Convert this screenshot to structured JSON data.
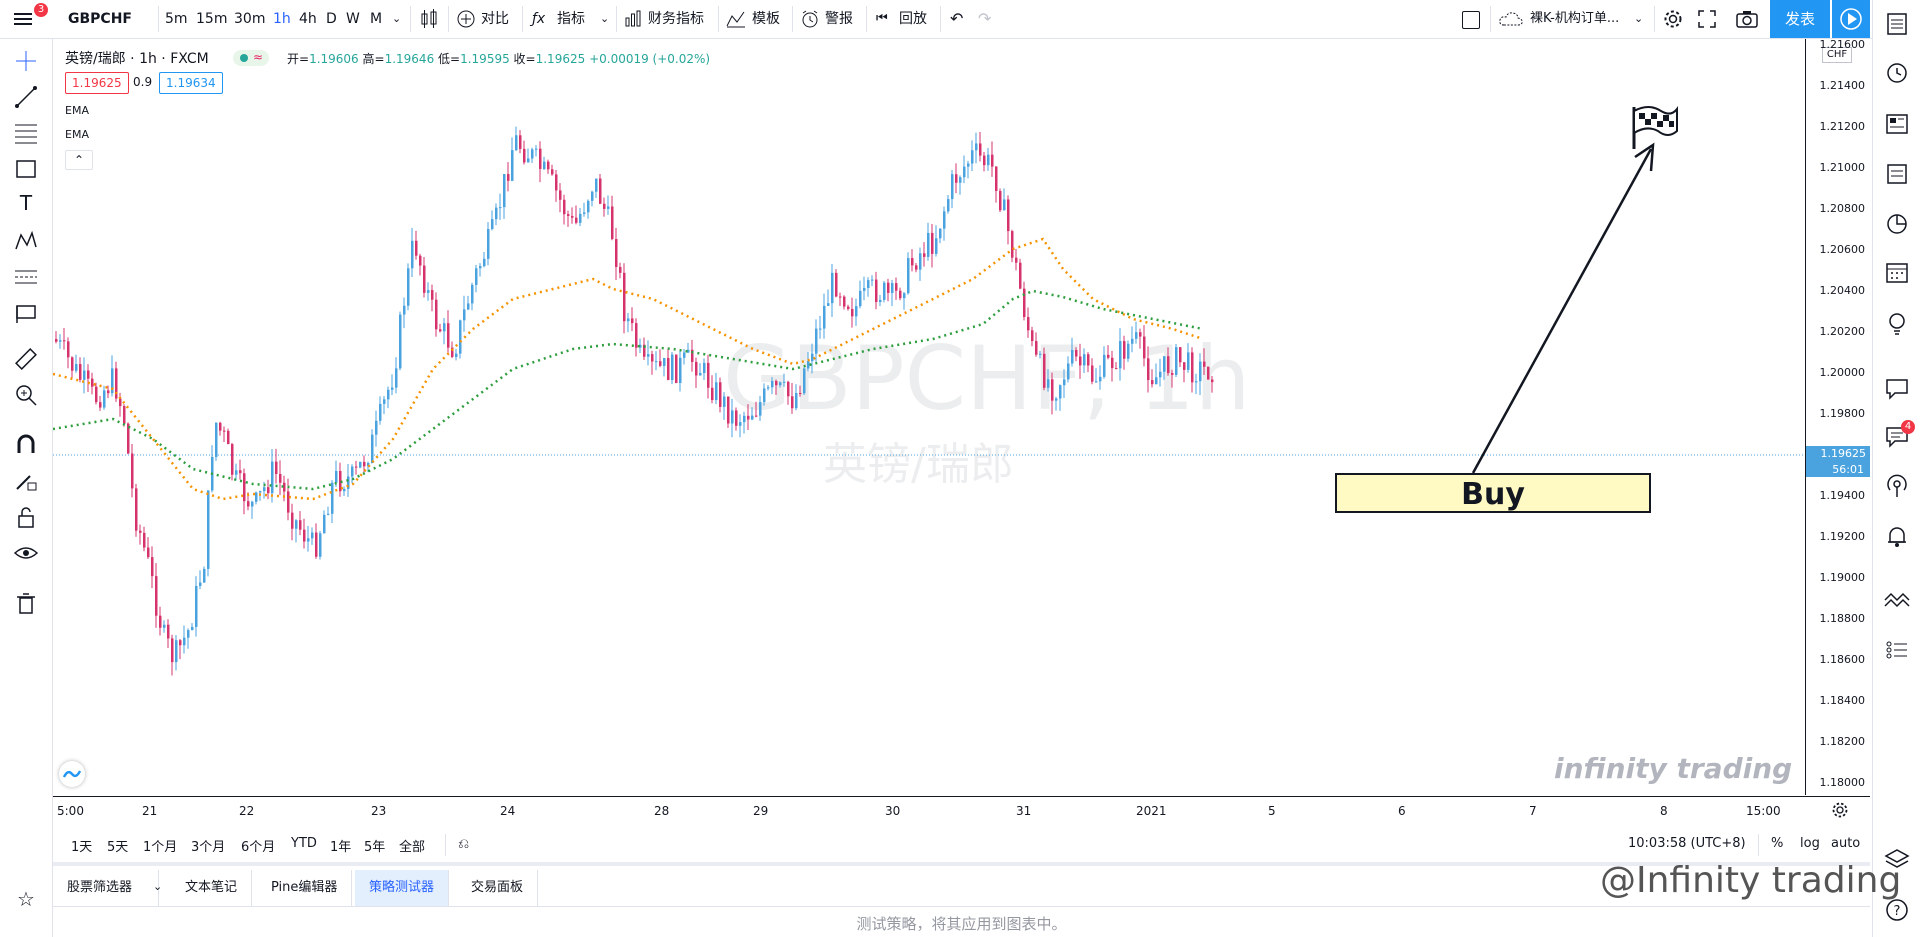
{
  "toolbar": {
    "menu_badge": "3",
    "symbol": "GBPCHF",
    "intervals": [
      "5m",
      "15m",
      "30m",
      "1h",
      "4h",
      "D",
      "W",
      "M"
    ],
    "selected_interval": "1h",
    "compare": "对比",
    "indicators": "指标",
    "financials": "财务指标",
    "templates": "模板",
    "alerts": "警报",
    "replay": "回放",
    "layout_name": "裸K-机构订单...",
    "publish": "发表"
  },
  "legend": {
    "title": "英镑/瑞郎 · 1h · FXCM",
    "open_label": "开=",
    "open": "1.19606",
    "high_label": "高=",
    "high": "1.19646",
    "low_label": "低=",
    "low": "1.19595",
    "close_label": "收=",
    "close": "1.19625",
    "change": "+0.00019 (+0.02%)",
    "bid": "1.19625",
    "spread": "0.9",
    "ask": "1.19634",
    "indicator1": "EMA",
    "indicator2": "EMA"
  },
  "watermark": {
    "line1": "GBPCHF, 1h",
    "line2": "英镑/瑞郎"
  },
  "price_axis": {
    "currency": "CHF",
    "labels": [
      "1.21600",
      "1.21400",
      "1.21200",
      "1.21000",
      "1.20800",
      "1.20600",
      "1.20400",
      "1.20200",
      "1.20000",
      "1.19800",
      "1.19625",
      "1.19400",
      "1.19200",
      "1.19000",
      "1.18800",
      "1.18600",
      "1.18400",
      "1.18200",
      "1.18000"
    ],
    "current_price": "1.19625",
    "countdown": "56:01"
  },
  "time_axis": {
    "labels": [
      "5:00",
      "21",
      "22",
      "23",
      "24",
      "28",
      "29",
      "30",
      "31",
      "2021",
      "5",
      "6",
      "7",
      "8",
      "15:00"
    ]
  },
  "annotation": {
    "buy": "Buy"
  },
  "range_bar": {
    "ranges": [
      "1天",
      "5天",
      "1个月",
      "3个月",
      "6个月",
      "YTD",
      "1年",
      "5年",
      "全部"
    ],
    "clock": "10:03:58 (UTC+8)",
    "percent": "%",
    "log": "log",
    "auto": "auto"
  },
  "bottom_tabs": [
    "股票筛选器",
    "文本笔记",
    "Pine编辑器",
    "策略测试器",
    "交易面板"
  ],
  "active_tab": "策略测试器",
  "message": "测试策略，将其应用到图表中。",
  "branding": {
    "chart_watermark": "infinity trading",
    "footer_watermark": "@Infinity trading"
  },
  "right_badge": "4",
  "colors": {
    "up": "#4aa3df",
    "down": "#d6336c",
    "ema_fast": "#f59300",
    "ema_slow": "#2e9e3e",
    "accent": "#2196f3"
  }
}
